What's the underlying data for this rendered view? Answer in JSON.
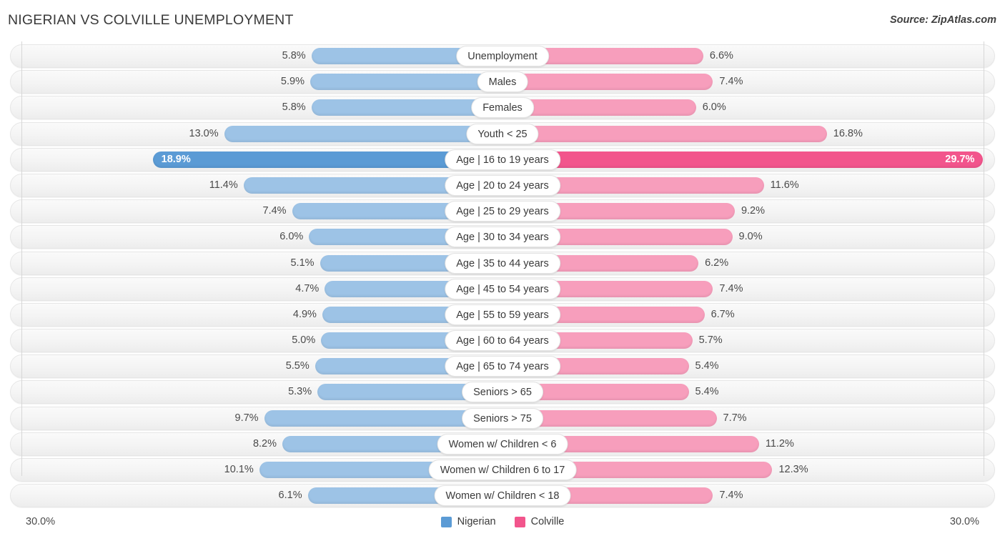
{
  "header": {
    "title": "NIGERIAN VS COLVILLE UNEMPLOYMENT",
    "source": "Source: ZipAtlas.com"
  },
  "axis": {
    "left_max_label": "30.0%",
    "right_max_label": "30.0%",
    "max_value": 30.0
  },
  "legend": {
    "items": [
      {
        "label": "Nigerian",
        "color": "#5b9bd5"
      },
      {
        "label": "Colville",
        "color": "#f2558c"
      }
    ]
  },
  "colors": {
    "left_bar": "#9dc3e6",
    "right_bar": "#f79ebc",
    "left_bar_highlight": "#5b9bd5",
    "right_bar_highlight": "#f2558c",
    "track": "#f4f4f4",
    "axis_line": "#d7d7d7"
  },
  "chart_data": {
    "type": "bar",
    "title": "NIGERIAN VS COLVILLE UNEMPLOYMENT",
    "subtitle": "",
    "xlabel": "",
    "ylabel": "",
    "orientation": "horizontal-diverging",
    "grid": false,
    "legend_position": "bottom-center",
    "xlim": [
      -30.0,
      30.0
    ],
    "axis_max": 30.0,
    "categories": [
      "Unemployment",
      "Males",
      "Females",
      "Youth < 25",
      "Age | 16 to 19 years",
      "Age | 20 to 24 years",
      "Age | 25 to 29 years",
      "Age | 30 to 34 years",
      "Age | 35 to 44 years",
      "Age | 45 to 54 years",
      "Age | 55 to 59 years",
      "Age | 60 to 64 years",
      "Age | 65 to 74 years",
      "Seniors > 65",
      "Seniors > 75",
      "Women w/ Children < 6",
      "Women w/ Children 6 to 17",
      "Women w/ Children < 18"
    ],
    "series": [
      {
        "name": "Nigerian",
        "side": "left",
        "color": "#9dc3e6",
        "values": [
          5.8,
          5.9,
          5.8,
          13.0,
          18.9,
          11.4,
          7.4,
          6.0,
          5.1,
          4.7,
          4.9,
          5.0,
          5.5,
          5.3,
          9.7,
          8.2,
          10.1,
          6.1
        ],
        "labels": [
          "5.8%",
          "5.9%",
          "5.8%",
          "13.0%",
          "18.9%",
          "11.4%",
          "7.4%",
          "6.0%",
          "5.1%",
          "4.7%",
          "4.9%",
          "5.0%",
          "5.5%",
          "5.3%",
          "9.7%",
          "8.2%",
          "10.1%",
          "6.1%"
        ]
      },
      {
        "name": "Colville",
        "side": "right",
        "color": "#f79ebc",
        "values": [
          6.6,
          7.4,
          6.0,
          16.8,
          29.7,
          11.6,
          9.2,
          9.0,
          6.2,
          7.4,
          6.7,
          5.7,
          5.4,
          5.4,
          7.7,
          11.2,
          12.3,
          7.4
        ],
        "labels": [
          "6.6%",
          "7.4%",
          "6.0%",
          "16.8%",
          "29.7%",
          "11.6%",
          "9.2%",
          "9.0%",
          "6.2%",
          "7.4%",
          "6.7%",
          "5.7%",
          "5.4%",
          "5.4%",
          "7.7%",
          "11.2%",
          "12.3%",
          "7.4%"
        ]
      }
    ],
    "highlighted_category": "Age | 16 to 19 years"
  },
  "rows": [
    {
      "label": "Unemployment",
      "left": "5.8%",
      "right": "6.6%",
      "left_value": 5.8,
      "right_value": 6.6,
      "highlight": false
    },
    {
      "label": "Males",
      "left": "5.9%",
      "right": "7.4%",
      "left_value": 5.9,
      "right_value": 7.4,
      "highlight": false
    },
    {
      "label": "Females",
      "left": "5.8%",
      "right": "6.0%",
      "left_value": 5.8,
      "right_value": 6.0,
      "highlight": false
    },
    {
      "label": "Youth < 25",
      "left": "13.0%",
      "right": "16.8%",
      "left_value": 13.0,
      "right_value": 16.8,
      "highlight": false
    },
    {
      "label": "Age | 16 to 19 years",
      "left": "18.9%",
      "right": "29.7%",
      "left_value": 18.9,
      "right_value": 29.7,
      "highlight": true
    },
    {
      "label": "Age | 20 to 24 years",
      "left": "11.4%",
      "right": "11.6%",
      "left_value": 11.4,
      "right_value": 11.6,
      "highlight": false
    },
    {
      "label": "Age | 25 to 29 years",
      "left": "7.4%",
      "right": "9.2%",
      "left_value": 7.4,
      "right_value": 9.2,
      "highlight": false
    },
    {
      "label": "Age | 30 to 34 years",
      "left": "6.0%",
      "right": "9.0%",
      "left_value": 6.0,
      "right_value": 9.0,
      "highlight": false
    },
    {
      "label": "Age | 35 to 44 years",
      "left": "5.1%",
      "right": "6.2%",
      "left_value": 5.1,
      "right_value": 6.2,
      "highlight": false
    },
    {
      "label": "Age | 45 to 54 years",
      "left": "4.7%",
      "right": "7.4%",
      "left_value": 4.7,
      "right_value": 7.4,
      "highlight": false
    },
    {
      "label": "Age | 55 to 59 years",
      "left": "4.9%",
      "right": "6.7%",
      "left_value": 4.9,
      "right_value": 6.7,
      "highlight": false
    },
    {
      "label": "Age | 60 to 64 years",
      "left": "5.0%",
      "right": "5.7%",
      "left_value": 5.0,
      "right_value": 5.7,
      "highlight": false
    },
    {
      "label": "Age | 65 to 74 years",
      "left": "5.5%",
      "right": "5.4%",
      "left_value": 5.5,
      "right_value": 5.4,
      "highlight": false
    },
    {
      "label": "Seniors > 65",
      "left": "5.3%",
      "right": "5.4%",
      "left_value": 5.3,
      "right_value": 5.4,
      "highlight": false
    },
    {
      "label": "Seniors > 75",
      "left": "9.7%",
      "right": "7.7%",
      "left_value": 9.7,
      "right_value": 7.7,
      "highlight": false
    },
    {
      "label": "Women w/ Children < 6",
      "left": "8.2%",
      "right": "11.2%",
      "left_value": 8.2,
      "right_value": 11.2,
      "highlight": false
    },
    {
      "label": "Women w/ Children 6 to 17",
      "left": "10.1%",
      "right": "12.3%",
      "left_value": 10.1,
      "right_value": 12.3,
      "highlight": false
    },
    {
      "label": "Women w/ Children < 18",
      "left": "6.1%",
      "right": "7.4%",
      "left_value": 6.1,
      "right_value": 7.4,
      "highlight": false
    }
  ]
}
